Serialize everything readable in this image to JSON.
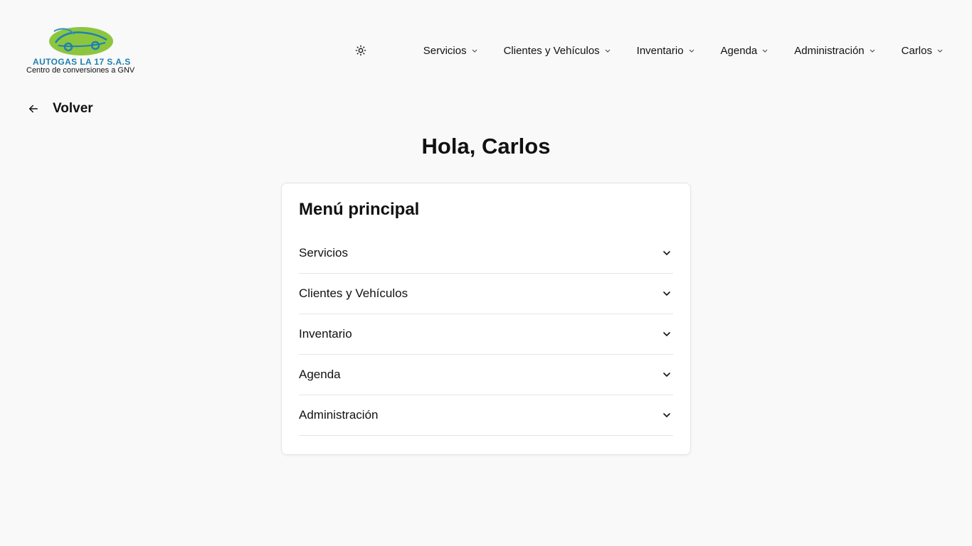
{
  "logo": {
    "title": "AUTOGAS LA 17 S.A.S",
    "subtitle": "Centro de conversiones a GNV",
    "colors": {
      "oval": "#8cc63f",
      "car": "#1f7fb3"
    }
  },
  "nav": {
    "theme_icon": "sun-icon",
    "items": [
      {
        "label": "Servicios"
      },
      {
        "label": "Clientes y Vehículos"
      },
      {
        "label": "Inventario"
      },
      {
        "label": "Agenda"
      },
      {
        "label": "Administración"
      },
      {
        "label": "Carlos"
      }
    ]
  },
  "back": {
    "label": "Volver",
    "icon": "arrow-left-icon"
  },
  "greeting": "Hola, Carlos",
  "menu": {
    "title": "Menú principal",
    "items": [
      {
        "label": "Servicios"
      },
      {
        "label": "Clientes y Vehículos"
      },
      {
        "label": "Inventario"
      },
      {
        "label": "Agenda"
      },
      {
        "label": "Administración"
      }
    ]
  }
}
